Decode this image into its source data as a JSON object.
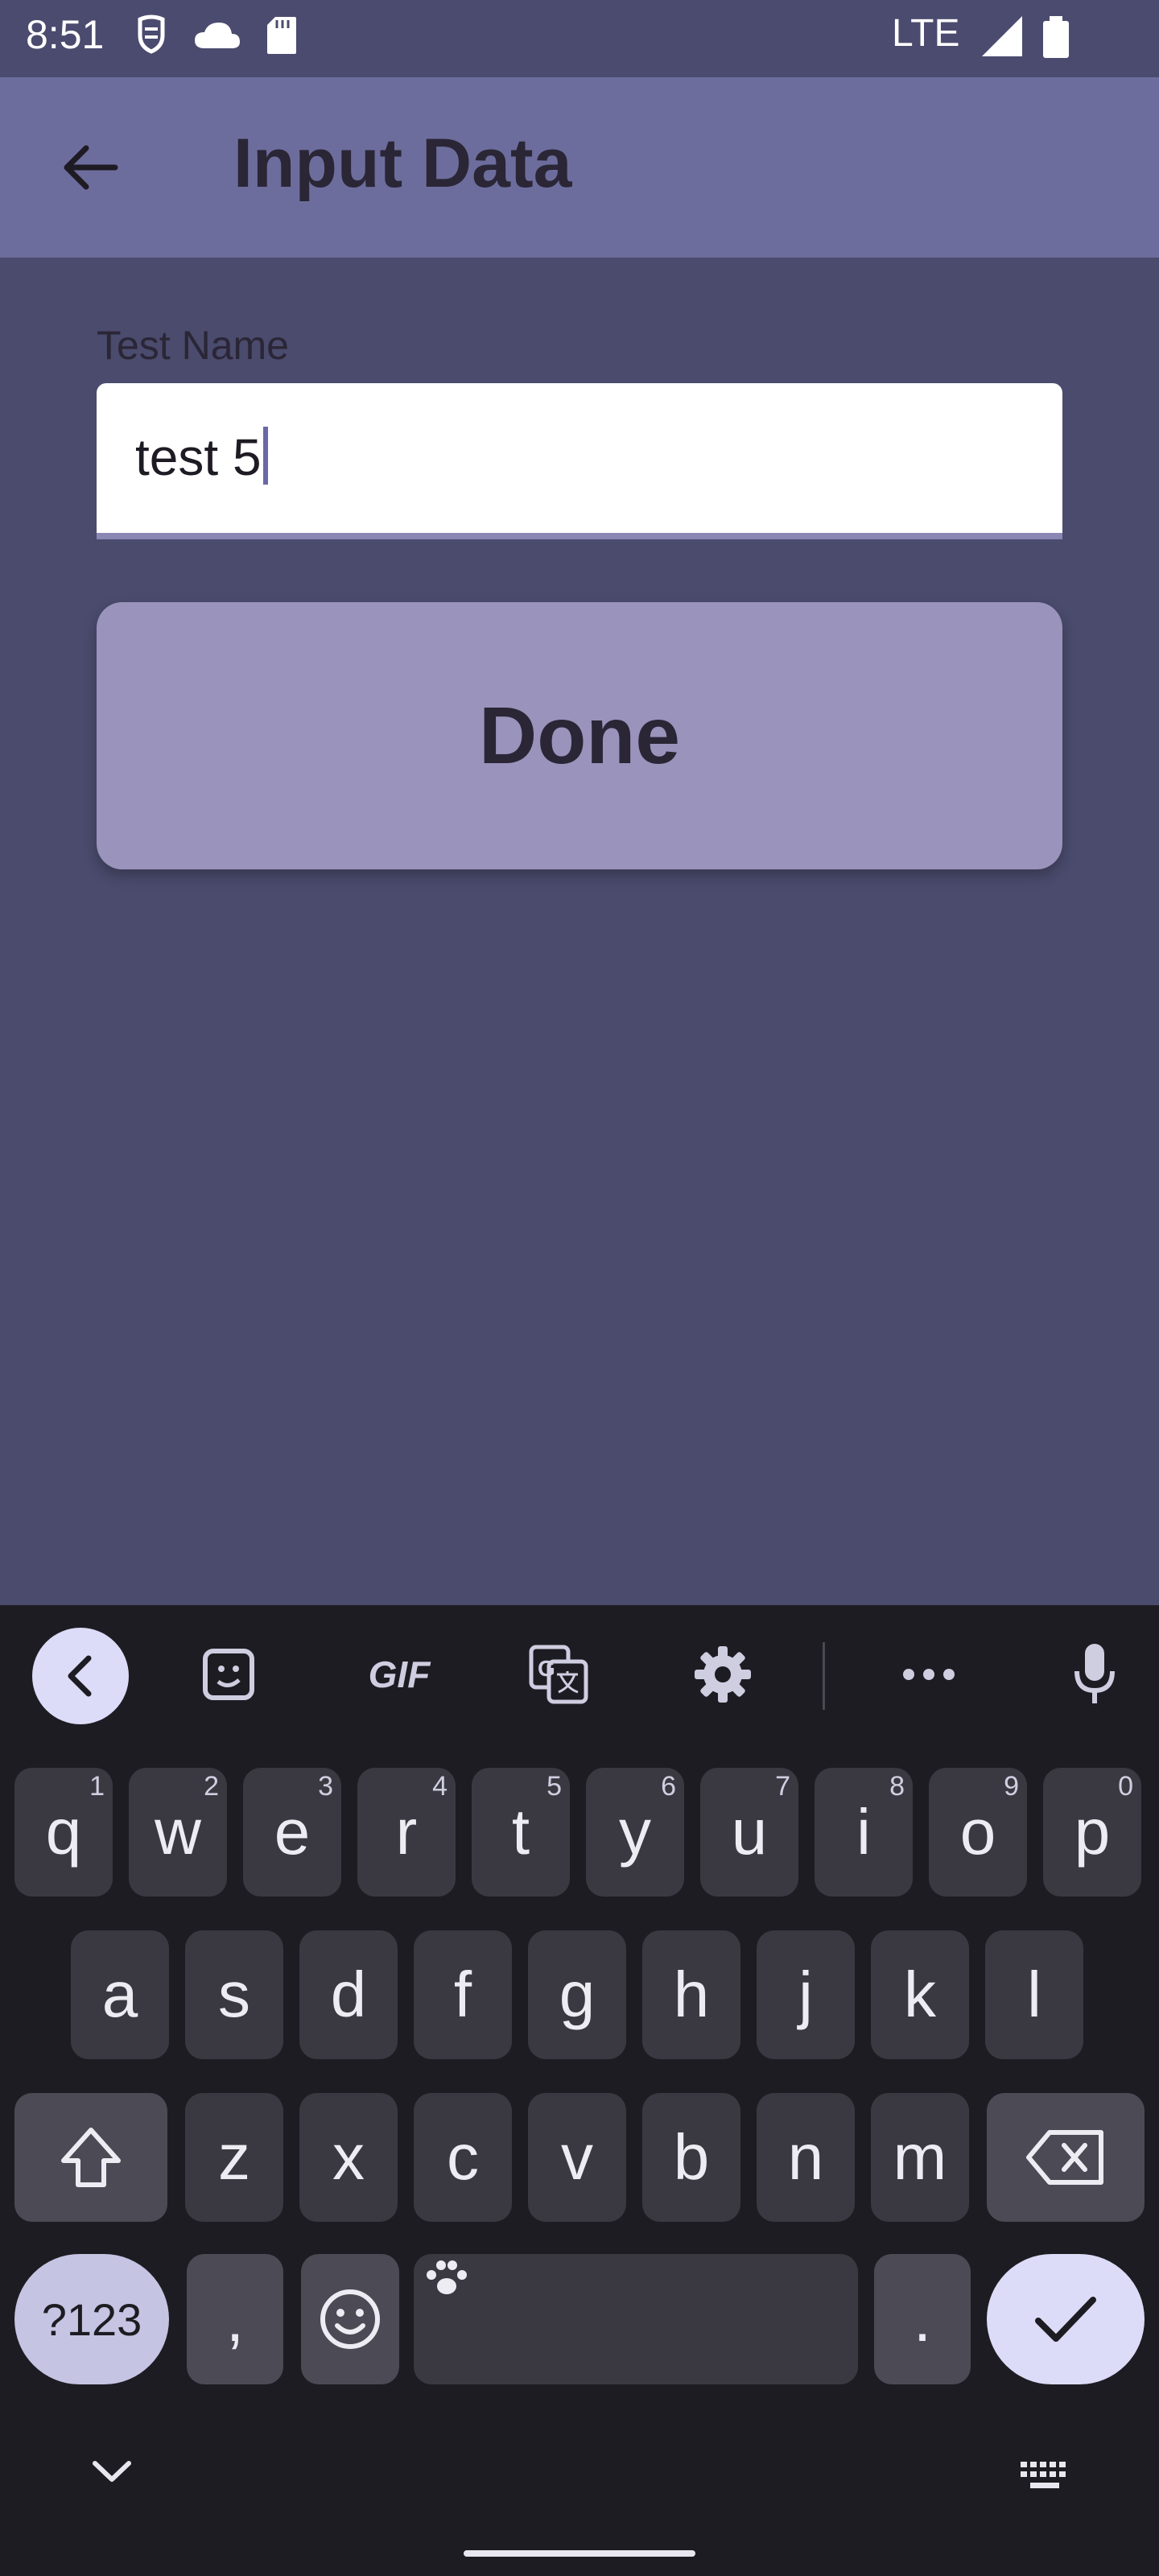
{
  "status_bar": {
    "time": "8:51",
    "network": "LTE"
  },
  "app_bar": {
    "title": "Input Data",
    "back_icon": "arrow-left-icon"
  },
  "form": {
    "field_label": "Test Name",
    "field_value": "test 5",
    "done_label": "Done"
  },
  "keyboard": {
    "toolbar": [
      "collapse-icon",
      "sticker-icon",
      "GIF",
      "translate-icon",
      "gear-icon",
      "more-icon",
      "mic-icon"
    ],
    "gif_label": "GIF",
    "row1": [
      {
        "k": "q",
        "h": "1"
      },
      {
        "k": "w",
        "h": "2"
      },
      {
        "k": "e",
        "h": "3"
      },
      {
        "k": "r",
        "h": "4"
      },
      {
        "k": "t",
        "h": "5"
      },
      {
        "k": "y",
        "h": "6"
      },
      {
        "k": "u",
        "h": "7"
      },
      {
        "k": "i",
        "h": "8"
      },
      {
        "k": "o",
        "h": "9"
      },
      {
        "k": "p",
        "h": "0"
      }
    ],
    "row2": [
      "a",
      "s",
      "d",
      "f",
      "g",
      "h",
      "j",
      "k",
      "l"
    ],
    "row3": [
      "z",
      "x",
      "c",
      "v",
      "b",
      "n",
      "m"
    ],
    "symbols_label": "?123",
    "comma_label": ",",
    "period_label": "."
  },
  "colors": {
    "background": "#4a4b6d",
    "app_bar": "#6d6d9d",
    "button": "#9a93bb",
    "keyboard": "#1d1c22",
    "key": "#3a3942",
    "accent_key": "#dcdcf8"
  }
}
